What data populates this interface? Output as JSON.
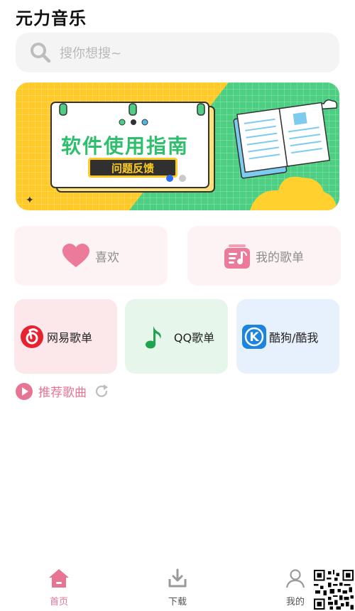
{
  "app": {
    "title": "元力音乐"
  },
  "search": {
    "placeholder": "搜你想搜~"
  },
  "banner": {
    "title": "软件使用指南",
    "button": "问题反馈",
    "dots": 2,
    "active_dot": 0
  },
  "quick": {
    "favorites": "喜欢",
    "my_playlists": "我的歌单"
  },
  "sources": [
    {
      "label": "网易歌单",
      "icon": "netease-music-icon",
      "color": "#e8212f"
    },
    {
      "label": "QQ歌单",
      "icon": "qq-music-icon",
      "color": "#1ea34f"
    },
    {
      "label": "酷狗/酷我",
      "icon": "kugou-icon",
      "color": "#1a84e0"
    }
  ],
  "recommend": {
    "label": "推荐歌曲"
  },
  "tabs": [
    {
      "label": "首页",
      "icon": "home-icon",
      "active": true
    },
    {
      "label": "下载",
      "icon": "download-icon",
      "active": false
    },
    {
      "label": "我的",
      "icon": "user-icon",
      "active": false
    }
  ],
  "colors": {
    "accent": "#e87493",
    "blue": "#2d6df6"
  }
}
